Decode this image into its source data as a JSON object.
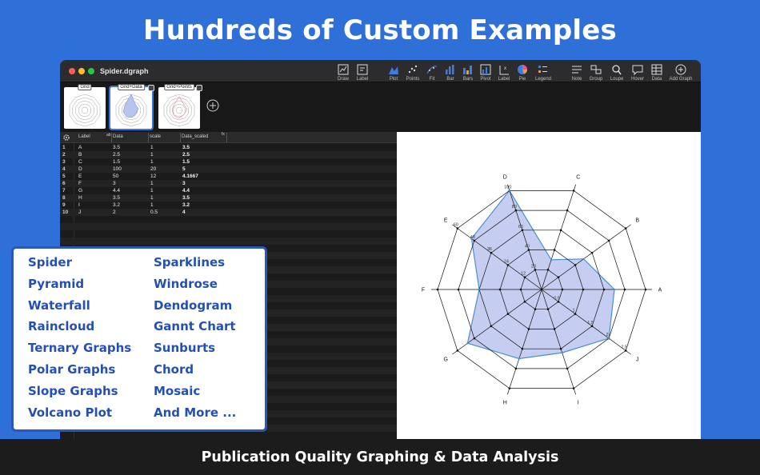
{
  "headline": "Hundreds of Custom Examples",
  "window": {
    "title": "Spider.dgraph"
  },
  "toolbar": [
    {
      "label": "Draw",
      "icon": "draw-icon"
    },
    {
      "label": "Label",
      "icon": "label-icon"
    },
    {
      "label": "Plot",
      "icon": "plot-icon"
    },
    {
      "label": "Points",
      "icon": "points-icon"
    },
    {
      "label": "Fit",
      "icon": "fit-icon"
    },
    {
      "label": "Bar",
      "icon": "bar-icon"
    },
    {
      "label": "Bars",
      "icon": "bars-icon"
    },
    {
      "label": "Pivot",
      "icon": "pivot-icon"
    },
    {
      "label": "Label",
      "icon": "axis-label-icon"
    },
    {
      "label": "Pie",
      "icon": "pie-icon"
    },
    {
      "label": "Legend",
      "icon": "legend-icon"
    },
    {
      "label": "Note",
      "icon": "note-icon"
    },
    {
      "label": "Group",
      "icon": "group-icon"
    },
    {
      "label": "Loupe",
      "icon": "loupe-icon"
    },
    {
      "label": "Hover",
      "icon": "hover-icon"
    },
    {
      "label": "Data",
      "icon": "data-icon"
    },
    {
      "label": "Add Graph",
      "icon": "add-graph-icon"
    }
  ],
  "thumbnails": [
    {
      "label": "Grid",
      "selected": false
    },
    {
      "label": "Grid+Data",
      "selected": true
    },
    {
      "label": "Grid+Points",
      "selected": false
    }
  ],
  "table": {
    "columns": [
      "Label",
      "Data",
      "scale",
      "Data_scaled"
    ],
    "rows": [
      [
        "1",
        "A",
        "3.5",
        "1",
        "3.5"
      ],
      [
        "2",
        "B",
        "2.5",
        "1",
        "2.5"
      ],
      [
        "3",
        "C",
        "1.5",
        "1",
        "1.5"
      ],
      [
        "4",
        "D",
        "100",
        "20",
        "5"
      ],
      [
        "5",
        "E",
        "50",
        "12",
        "4.1667"
      ],
      [
        "6",
        "F",
        "3",
        "1",
        "3"
      ],
      [
        "7",
        "G",
        "4.4",
        "1",
        "4.4"
      ],
      [
        "8",
        "H",
        "3.5",
        "1",
        "3.5"
      ],
      [
        "9",
        "I",
        "3.2",
        "1",
        "3.2"
      ],
      [
        "10",
        "J",
        "2",
        "0.5",
        "4"
      ]
    ]
  },
  "chart_data": {
    "type": "radar",
    "categories": [
      "A",
      "B",
      "C",
      "D",
      "E",
      "F",
      "G",
      "H",
      "I",
      "J"
    ],
    "values": [
      3.5,
      2.5,
      1.5,
      5,
      4.1667,
      3,
      4.4,
      3.5,
      3.2,
      4
    ],
    "rmax": 5,
    "rings": 5,
    "ring_labels": {
      "D": [
        "20",
        "40",
        "60",
        "80",
        "100"
      ],
      "E": [
        "12",
        "24",
        "36",
        "48",
        "60"
      ],
      "J": [
        "0.5",
        "1",
        "1.5",
        "2",
        "2.5"
      ]
    },
    "fill_color": "#c5cdf0",
    "line_color": "#4a8fd0",
    "grid_color": "#111111"
  },
  "examples_list": {
    "left": [
      "Spider",
      "Pyramid",
      "Waterfall",
      "Raincloud",
      "Ternary Graphs",
      "Polar Graphs",
      "Slope Graphs",
      "Volcano Plot"
    ],
    "right": [
      "Sparklines",
      "Windrose",
      "Dendogram",
      "Gannt Chart",
      "Sunburts",
      "Chord",
      "Mosaic",
      "And More ..."
    ]
  },
  "footer": "Publication Quality Graphing & Data Analysis",
  "colors": {
    "background": "#2f6fd8",
    "list_text": "#2450b3",
    "selection": "#3a73e6"
  }
}
